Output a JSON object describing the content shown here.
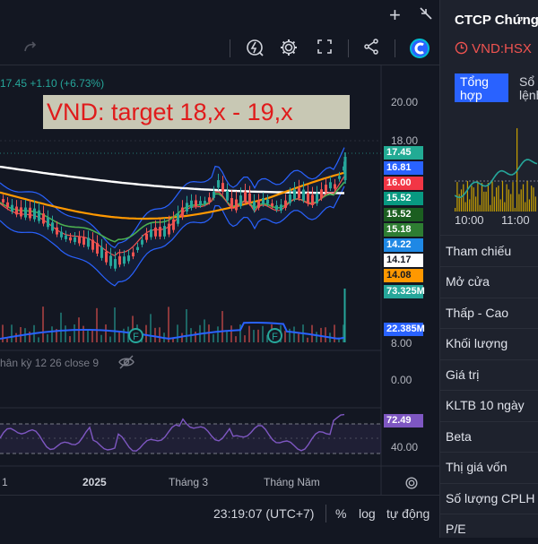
{
  "header": {
    "plus_icon": "+",
    "company_name": "CTCP Chứng",
    "ticker": "VND:HSX",
    "tab_overview": [
      "Tổng",
      "hợp"
    ],
    "tab_orders": [
      "Sổ",
      "lệnh"
    ]
  },
  "toolbar": {
    "icons": [
      "redo-icon",
      "lightning-icon",
      "gear-icon",
      "fullscreen-icon",
      "share-icon",
      "logo-icon"
    ]
  },
  "chart": {
    "ohlc_line": "17.45 +1.10 (+6.73%)",
    "annotation": "VND: target 18,x - 19,x",
    "macd_legend": "hân kỳ 12 26 close 9",
    "price_axis": [
      "20.00",
      "18.00",
      "8.00"
    ],
    "price_labels": [
      {
        "value": "17.45",
        "bg": "#22ab94",
        "fg": "#ffffff"
      },
      {
        "value": "16.81",
        "bg": "#2962ff",
        "fg": "#ffffff"
      },
      {
        "value": "16.00",
        "bg": "#f23645",
        "fg": "#ffffff"
      },
      {
        "value": "15.52",
        "bg": "#089981",
        "fg": "#ffffff"
      },
      {
        "value": "15.52",
        "bg": "#1b5e20",
        "fg": "#ffffff"
      },
      {
        "value": "15.18",
        "bg": "#2e7d32",
        "fg": "#ffffff"
      },
      {
        "value": "14.22",
        "bg": "#1e88e5",
        "fg": "#ffffff"
      },
      {
        "value": "14.17",
        "bg": "#ffffff",
        "fg": "#131722"
      },
      {
        "value": "14.08",
        "bg": "#ff9800",
        "fg": "#131722"
      },
      {
        "value": "73.325M",
        "bg": "#26a69a",
        "fg": "#ffffff"
      },
      {
        "value": "22.385M",
        "bg": "#2962ff",
        "fg": "#ffffff"
      }
    ],
    "macd_axis": "0.00",
    "rsi_label": "72.49",
    "rsi_axis": "40.00",
    "x_labels": [
      "1",
      "2025",
      "Tháng 3",
      "Tháng Năm"
    ],
    "flag_text": "F",
    "colors": {
      "up": "#26a69a",
      "down": "#ef5350",
      "ma_white": "#ffffff",
      "ma_orange": "#ff9800",
      "bb": "#2962ff",
      "rsi": "#7e57c2",
      "volume_ma": "#2962ff"
    }
  },
  "bottom": {
    "time": "23:19:07 (UTC+7)",
    "percent": "%",
    "log": "log",
    "auto": "tự động"
  },
  "sidebar": {
    "chart_times": [
      "10:00",
      "11:00"
    ],
    "rows": [
      "Tham chiếu",
      "Mở cửa",
      "Thấp - Cao",
      "Khối lượng",
      "Giá trị",
      "KLTB 10 ngày",
      "Beta",
      "Thị giá vốn",
      "Số lượng CPLH",
      "P/E"
    ]
  }
}
